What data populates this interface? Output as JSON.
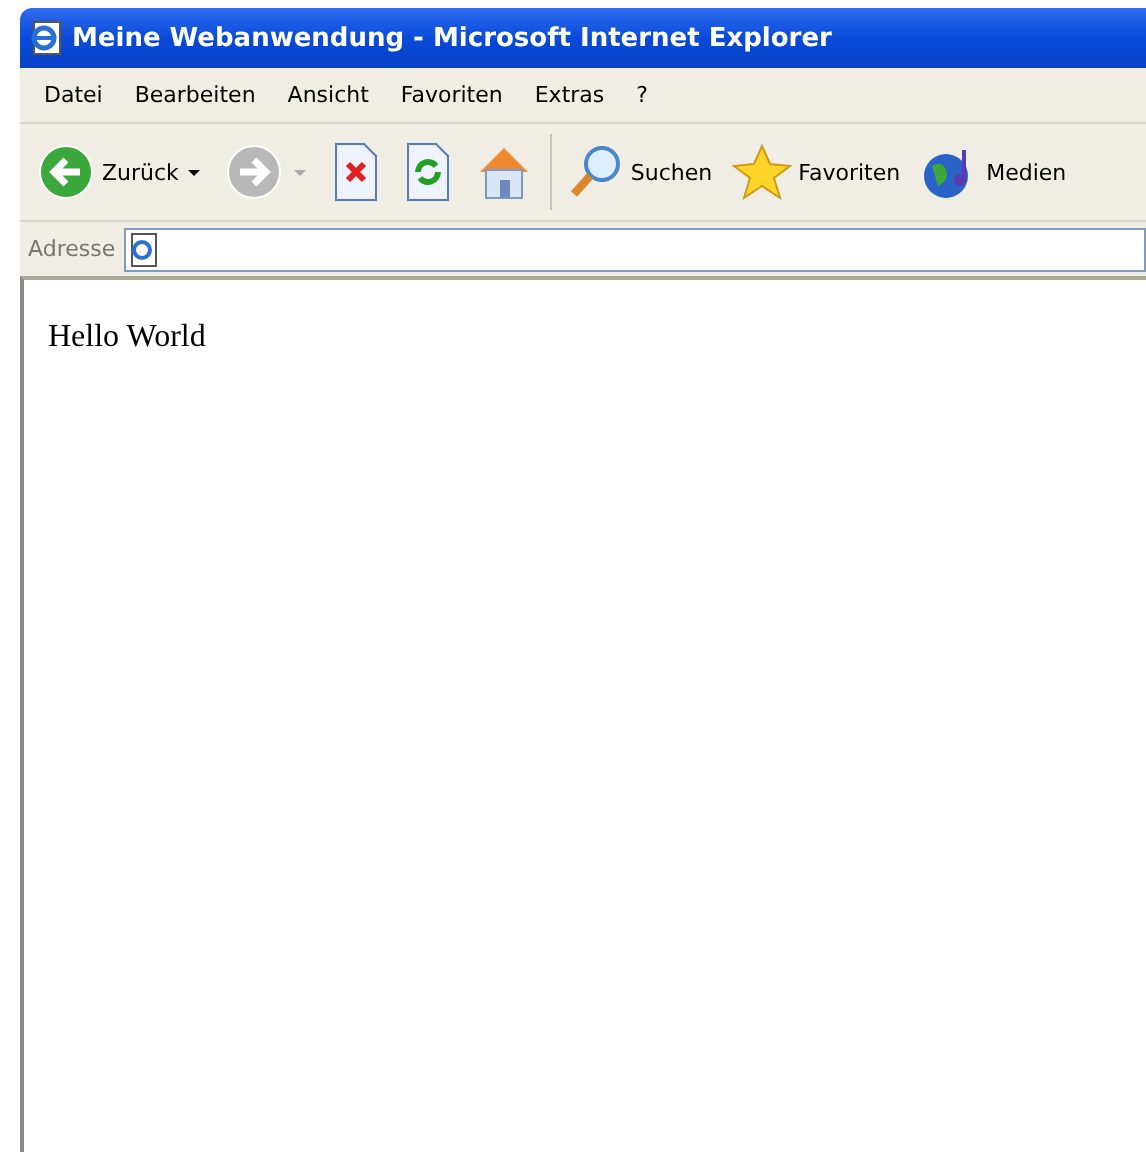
{
  "window": {
    "title": "Meine Webanwendung - Microsoft Internet Explorer"
  },
  "menu": [
    "Datei",
    "Bearbeiten",
    "Ansicht",
    "Favoriten",
    "Extras",
    "?"
  ],
  "toolbar": [
    {
      "kind": "back",
      "label": "Zurück",
      "disabled": false
    },
    {
      "kind": "forward",
      "disabled": true
    },
    {
      "kind": "stop"
    },
    {
      "kind": "refresh"
    },
    {
      "kind": "home"
    },
    {
      "kind": "separator"
    },
    {
      "kind": "search",
      "label": "Suchen"
    },
    {
      "kind": "favorites",
      "label": "Favoriten"
    },
    {
      "kind": "media",
      "label": "Medien"
    }
  ],
  "address_bar": {
    "label": "Adresse"
  },
  "content": {
    "text": "Hello World"
  }
}
